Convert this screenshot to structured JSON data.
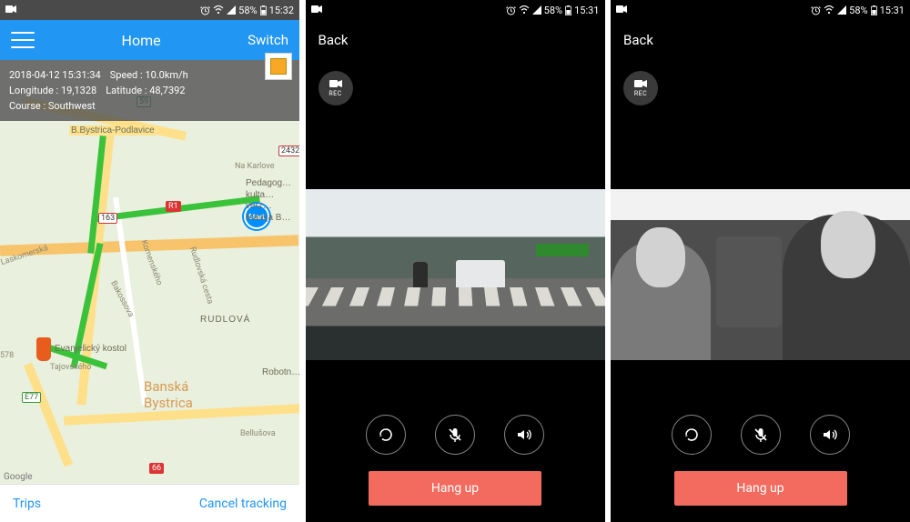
{
  "status_bar": {
    "camera_icon": "camcorder",
    "alarm_icon": "alarm",
    "wifi_icon": "wifi",
    "signal_icon": "signal",
    "battery_pct": "58%",
    "battery_icon": "battery",
    "map_time": "15:32",
    "video_time": "15:31"
  },
  "map_screen": {
    "app_bar": {
      "title": "Home",
      "switch_label": "Switch"
    },
    "info": {
      "timestamp": "2018-04-12 15:31:34",
      "speed_label": "Speed :",
      "speed_value": "10.0km/h",
      "longitude_label": "Longitude :",
      "longitude_value": "19,1328",
      "latitude_label": "Latitude :",
      "latitude_value": "48,7392",
      "course_label": "Course :",
      "course_value": "Southwest"
    },
    "start_marker_label": "Start",
    "places": {
      "bb_podlavice": "B.Bystrica-Podlavice",
      "na_karlove": "Na Karlove",
      "laskomerska": "Laskomerská",
      "komenskeho": "Komenského",
      "bakossova": "Bakossova",
      "rudlovska": "Rudlovská cesta",
      "rudlova": "RUDLOVÁ",
      "evanjelicky": "Evanjelický kostol",
      "tajovskeho": "Tajovského",
      "city": "Banská\nBystrica",
      "bellusova": "Bellušova",
      "pedagog": "Pedagog…\nkulta…\nverz…\nMateja B…",
      "robotn": "Robotn…",
      "elev_578": "578",
      "road_163": "163",
      "road_R1": "R1",
      "road_59": "59",
      "road_E77": "E77",
      "road_66": "66",
      "road_2432": "2432"
    },
    "google_mark": "Google",
    "toolbar": {
      "trips": "Trips",
      "cancel": "Cancel tracking"
    }
  },
  "video_screen": {
    "back_label": "Back",
    "rec_label": "REC",
    "hangup_label": "Hang up",
    "controls": {
      "refresh": "refresh",
      "mic": "mic-mute",
      "speaker": "speaker"
    }
  }
}
